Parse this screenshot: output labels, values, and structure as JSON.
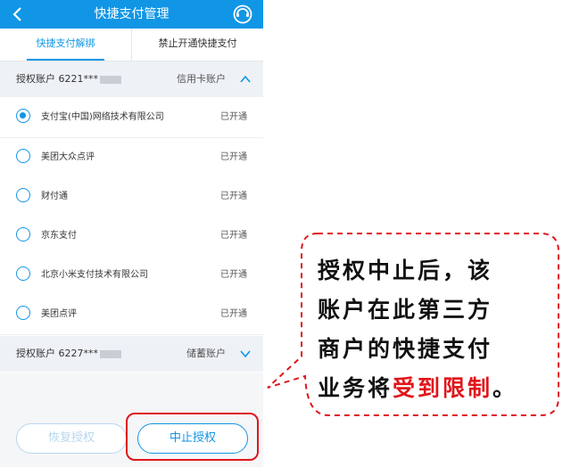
{
  "header": {
    "title": "快捷支付管理"
  },
  "tabs": [
    {
      "label": "快捷支付解绑",
      "active": true
    },
    {
      "label": "禁止开通快捷支付",
      "active": false
    }
  ],
  "accounts": [
    {
      "label": "授权账户 6221***",
      "type": "信用卡账户",
      "expanded": true
    },
    {
      "label": "授权账户 6227***",
      "type": "储蓄账户",
      "expanded": false
    }
  ],
  "merchants": [
    {
      "name": "支付宝(中国)网络技术有限公司",
      "status": "已开通",
      "selected": true
    },
    {
      "name": "美团大众点评",
      "status": "已开通",
      "selected": false
    },
    {
      "name": "财付通",
      "status": "已开通",
      "selected": false
    },
    {
      "name": "京东支付",
      "status": "已开通",
      "selected": false
    },
    {
      "name": "北京小米支付技术有限公司",
      "status": "已开通",
      "selected": false
    },
    {
      "name": "美团点评",
      "status": "已开通",
      "selected": false
    }
  ],
  "buttons": {
    "restore": "恢复授权",
    "stop": "中止授权"
  },
  "callout": {
    "line1": "授权中止后，该",
    "line2": "账户在此第三方",
    "line3": "商户的快捷支付",
    "line4_prefix": "业务将",
    "line4_red": "受到限制",
    "line4_suffix": "。"
  },
  "colors": {
    "brand": "#1196e6",
    "highlight": "#e0161b"
  }
}
